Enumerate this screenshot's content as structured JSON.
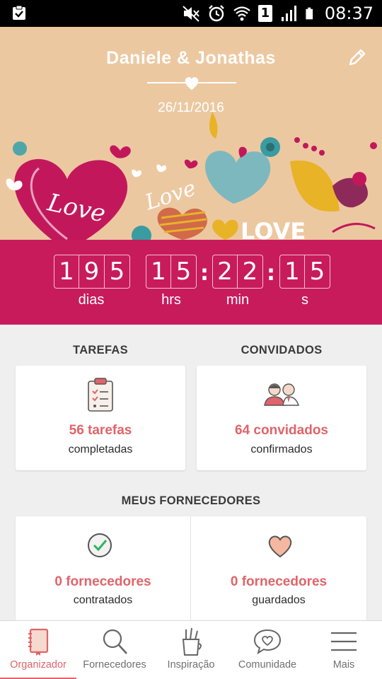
{
  "status_bar": {
    "time": "08:37",
    "sim_label": "1",
    "icons": [
      "clipboard-check-icon",
      "mute-icon",
      "alarm-icon",
      "wifi-icon",
      "sim-icon",
      "signal-icon",
      "battery-icon"
    ]
  },
  "header": {
    "couple_names": "Daniele & Jonathas",
    "wedding_date": "26/11/2016",
    "illustration_words": [
      "Love",
      "Love",
      "LOVE"
    ]
  },
  "countdown": {
    "days": [
      "1",
      "9",
      "5"
    ],
    "hours": [
      "1",
      "5"
    ],
    "minutes": [
      "2",
      "2"
    ],
    "seconds": [
      "1",
      "5"
    ],
    "labels": {
      "days": "dias",
      "hours": "hrs",
      "minutes": "min",
      "seconds": "s"
    },
    "separator": ":"
  },
  "tasks": {
    "title": "TAREFAS",
    "count_text": "56 tarefas",
    "status_text": "completadas"
  },
  "guests": {
    "title": "CONVIDADOS",
    "count_text": "64 convidados",
    "status_text": "confirmados"
  },
  "suppliers": {
    "title": "MEUS FORNECEDORES",
    "hired_count": "0 fornecedores",
    "hired_label": "contratados",
    "saved_count": "0 fornecedores",
    "saved_label": "guardados"
  },
  "bottom_nav": [
    {
      "label": "Organizador",
      "icon": "notebook-icon",
      "active": true
    },
    {
      "label": "Fornecedores",
      "icon": "search-icon",
      "active": false
    },
    {
      "label": "Inspiração",
      "icon": "pencil-cup-icon",
      "active": false
    },
    {
      "label": "Comunidade",
      "icon": "heart-chat-icon",
      "active": false
    },
    {
      "label": "Mais",
      "icon": "menu-icon",
      "active": false
    }
  ],
  "colors": {
    "accent": "#e0646a",
    "countdown_bg": "#c81b5c",
    "banner_bg": "#ecc8a1"
  }
}
